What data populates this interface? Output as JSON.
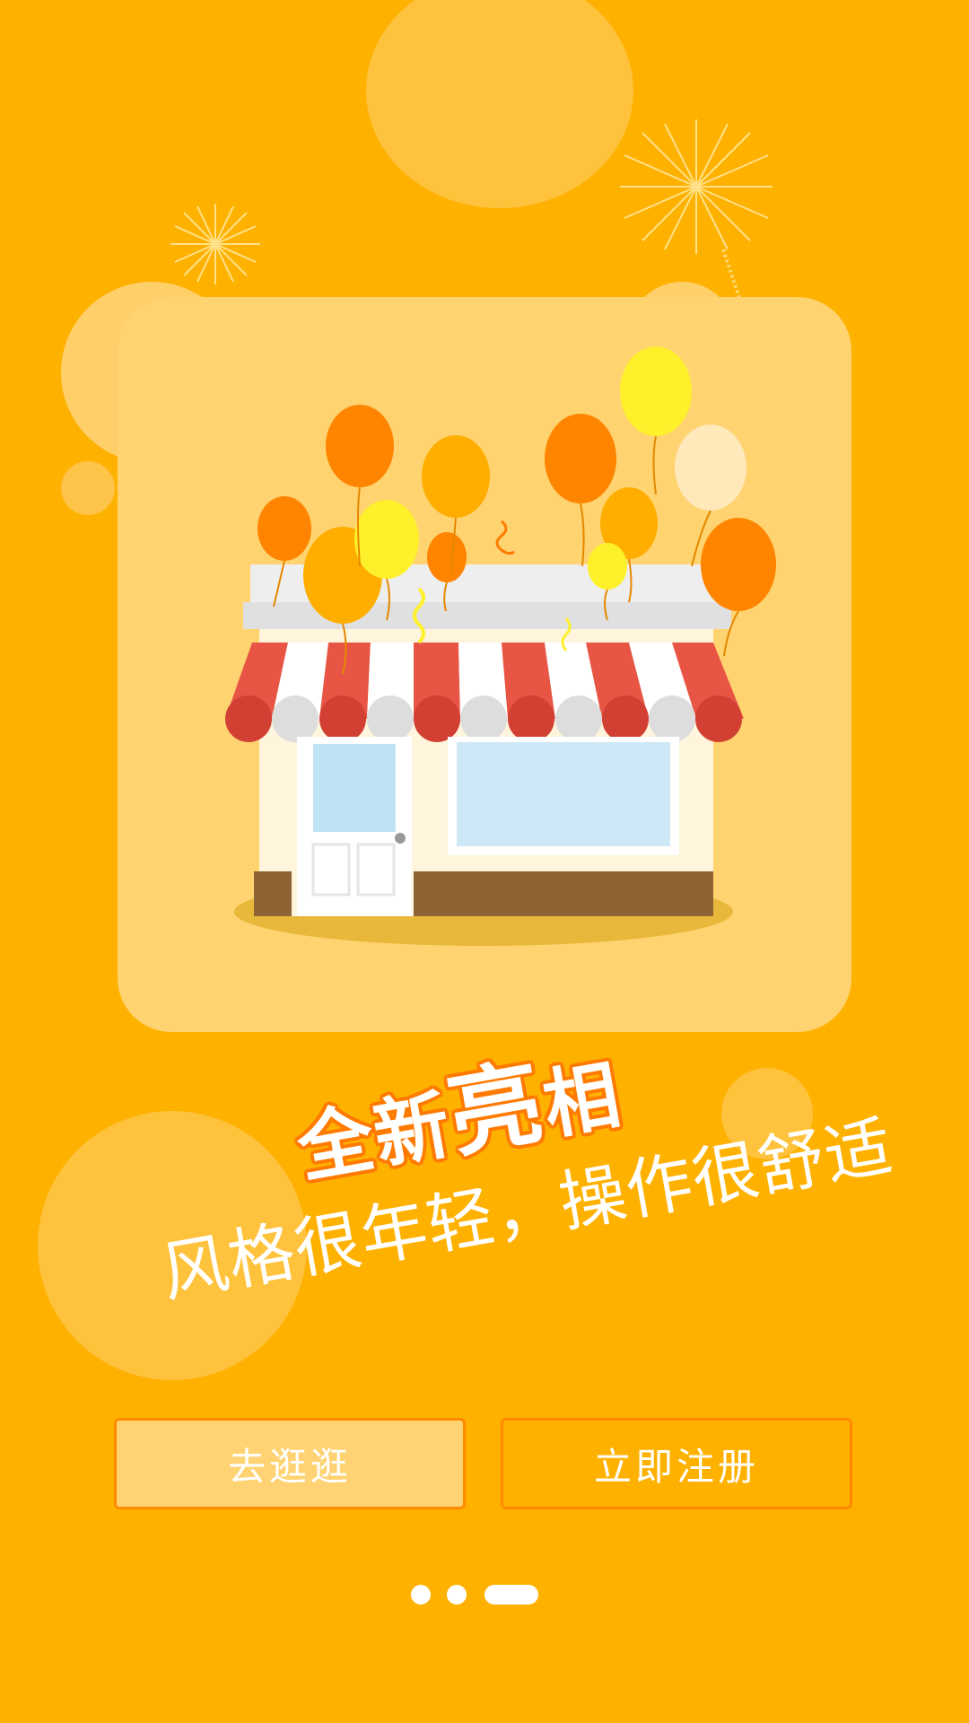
{
  "headline": {
    "part1": "全新",
    "part2": "亮",
    "part3": "相"
  },
  "subline": "风格很年轻，操作很舒适",
  "buttons": {
    "browse_label": "去逛逛",
    "register_label": "立即注册"
  },
  "pager": {
    "total": 3,
    "active_index": 2
  },
  "colors": {
    "background": "#FFB100",
    "card": "#FFD36F",
    "accent": "#FF7A00",
    "awning_red": "#E85545"
  }
}
